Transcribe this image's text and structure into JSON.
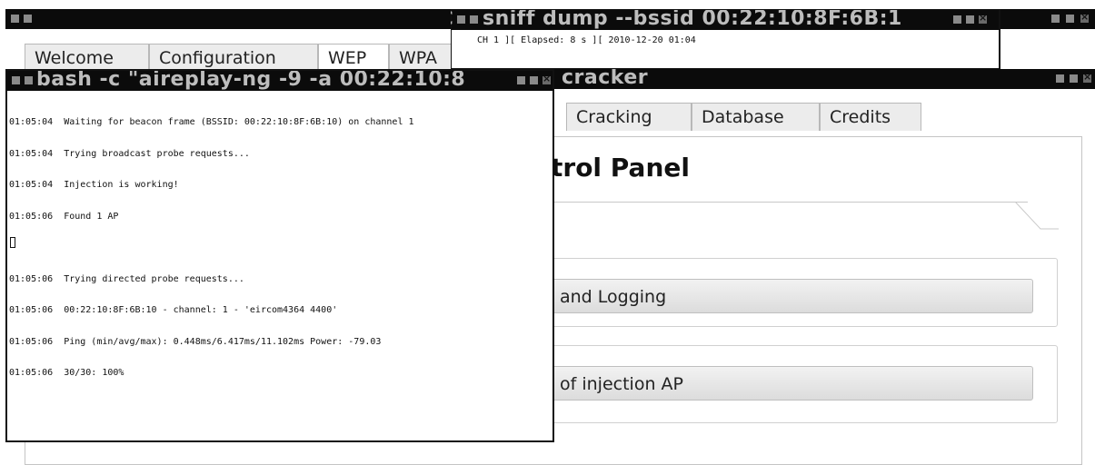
{
  "main_window": {
    "tabs": [
      "Welcome",
      "Configuration",
      "WEP",
      "WPA",
      "Cracking",
      "Database",
      "Credits"
    ],
    "panel_title": "trol Panel",
    "buttons": [
      "and Logging",
      "of injection AP"
    ]
  },
  "sniff_window": {
    "title": "sniff dump --bssid 00:22:10:8F:6B:1",
    "title_prefix": "C",
    "status_line": "CH  1 ][ Elapsed: 8 s ][ 2010-12-20 01:04"
  },
  "cracker_window": {
    "title": "cracker"
  },
  "bash_window": {
    "title": "bash -c \"aireplay-ng -9 -a 00:22:10:8",
    "lines": [
      "01:05:04  Waiting for beacon frame (BSSID: 00:22:10:8F:6B:10) on channel 1",
      "01:05:04  Trying broadcast probe requests...",
      "01:05:04  Injection is working!",
      "01:05:06  Found 1 AP",
      "",
      "01:05:06  Trying directed probe requests...",
      "01:05:06  00:22:10:8F:6B:10 - channel: 1 - 'eircom4364 4400'",
      "01:05:06  Ping (min/avg/max): 0.448ms/6.417ms/11.102ms Power: -79.03",
      "01:05:06  30/30: 100%"
    ]
  }
}
